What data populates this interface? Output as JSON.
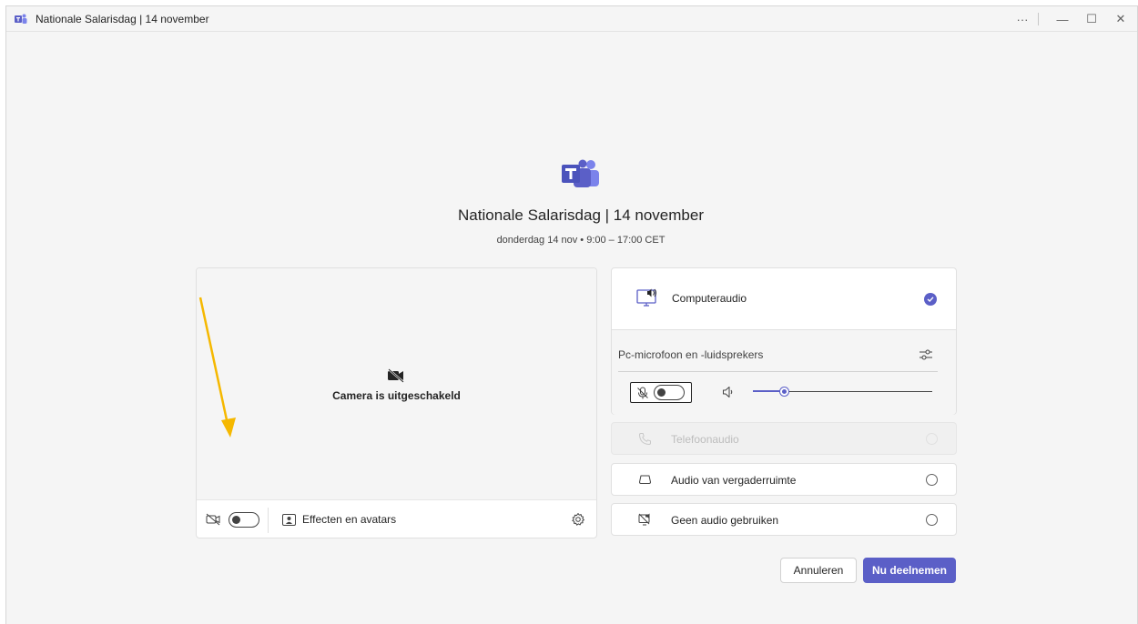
{
  "window": {
    "title": "Nationale Salarisdag | 14 november",
    "controls": {
      "more": "···",
      "minimize": "—",
      "maximize": "☐",
      "close": "✕"
    }
  },
  "meeting": {
    "title": "Nationale Salarisdag | 14 november",
    "time": "donderdag 14 nov  •  9:00  –  17:00 CET"
  },
  "preview": {
    "camera_off_text": "Camera is uitgeschakeld",
    "camera_toggle_on": false,
    "effects_label": "Effecten en avatars"
  },
  "audio": {
    "computer_audio_label": "Computeraudio",
    "computer_audio_selected": true,
    "device_label": "Pc-microfoon en -luidsprekers",
    "mic_on": false,
    "speaker_volume": 0.18,
    "options": [
      {
        "label": "Telefoonaudio",
        "icon": "phone-icon",
        "disabled": true
      },
      {
        "label": "Audio van vergaderruimte",
        "icon": "room-audio-icon",
        "disabled": false
      },
      {
        "label": "Geen audio gebruiken",
        "icon": "no-audio-icon",
        "disabled": false
      }
    ]
  },
  "actions": {
    "cancel_label": "Annuleren",
    "join_label": "Nu deelnemen"
  },
  "colors": {
    "accent": "#5b5fc7",
    "annotation_arrow": "#f5b800"
  }
}
